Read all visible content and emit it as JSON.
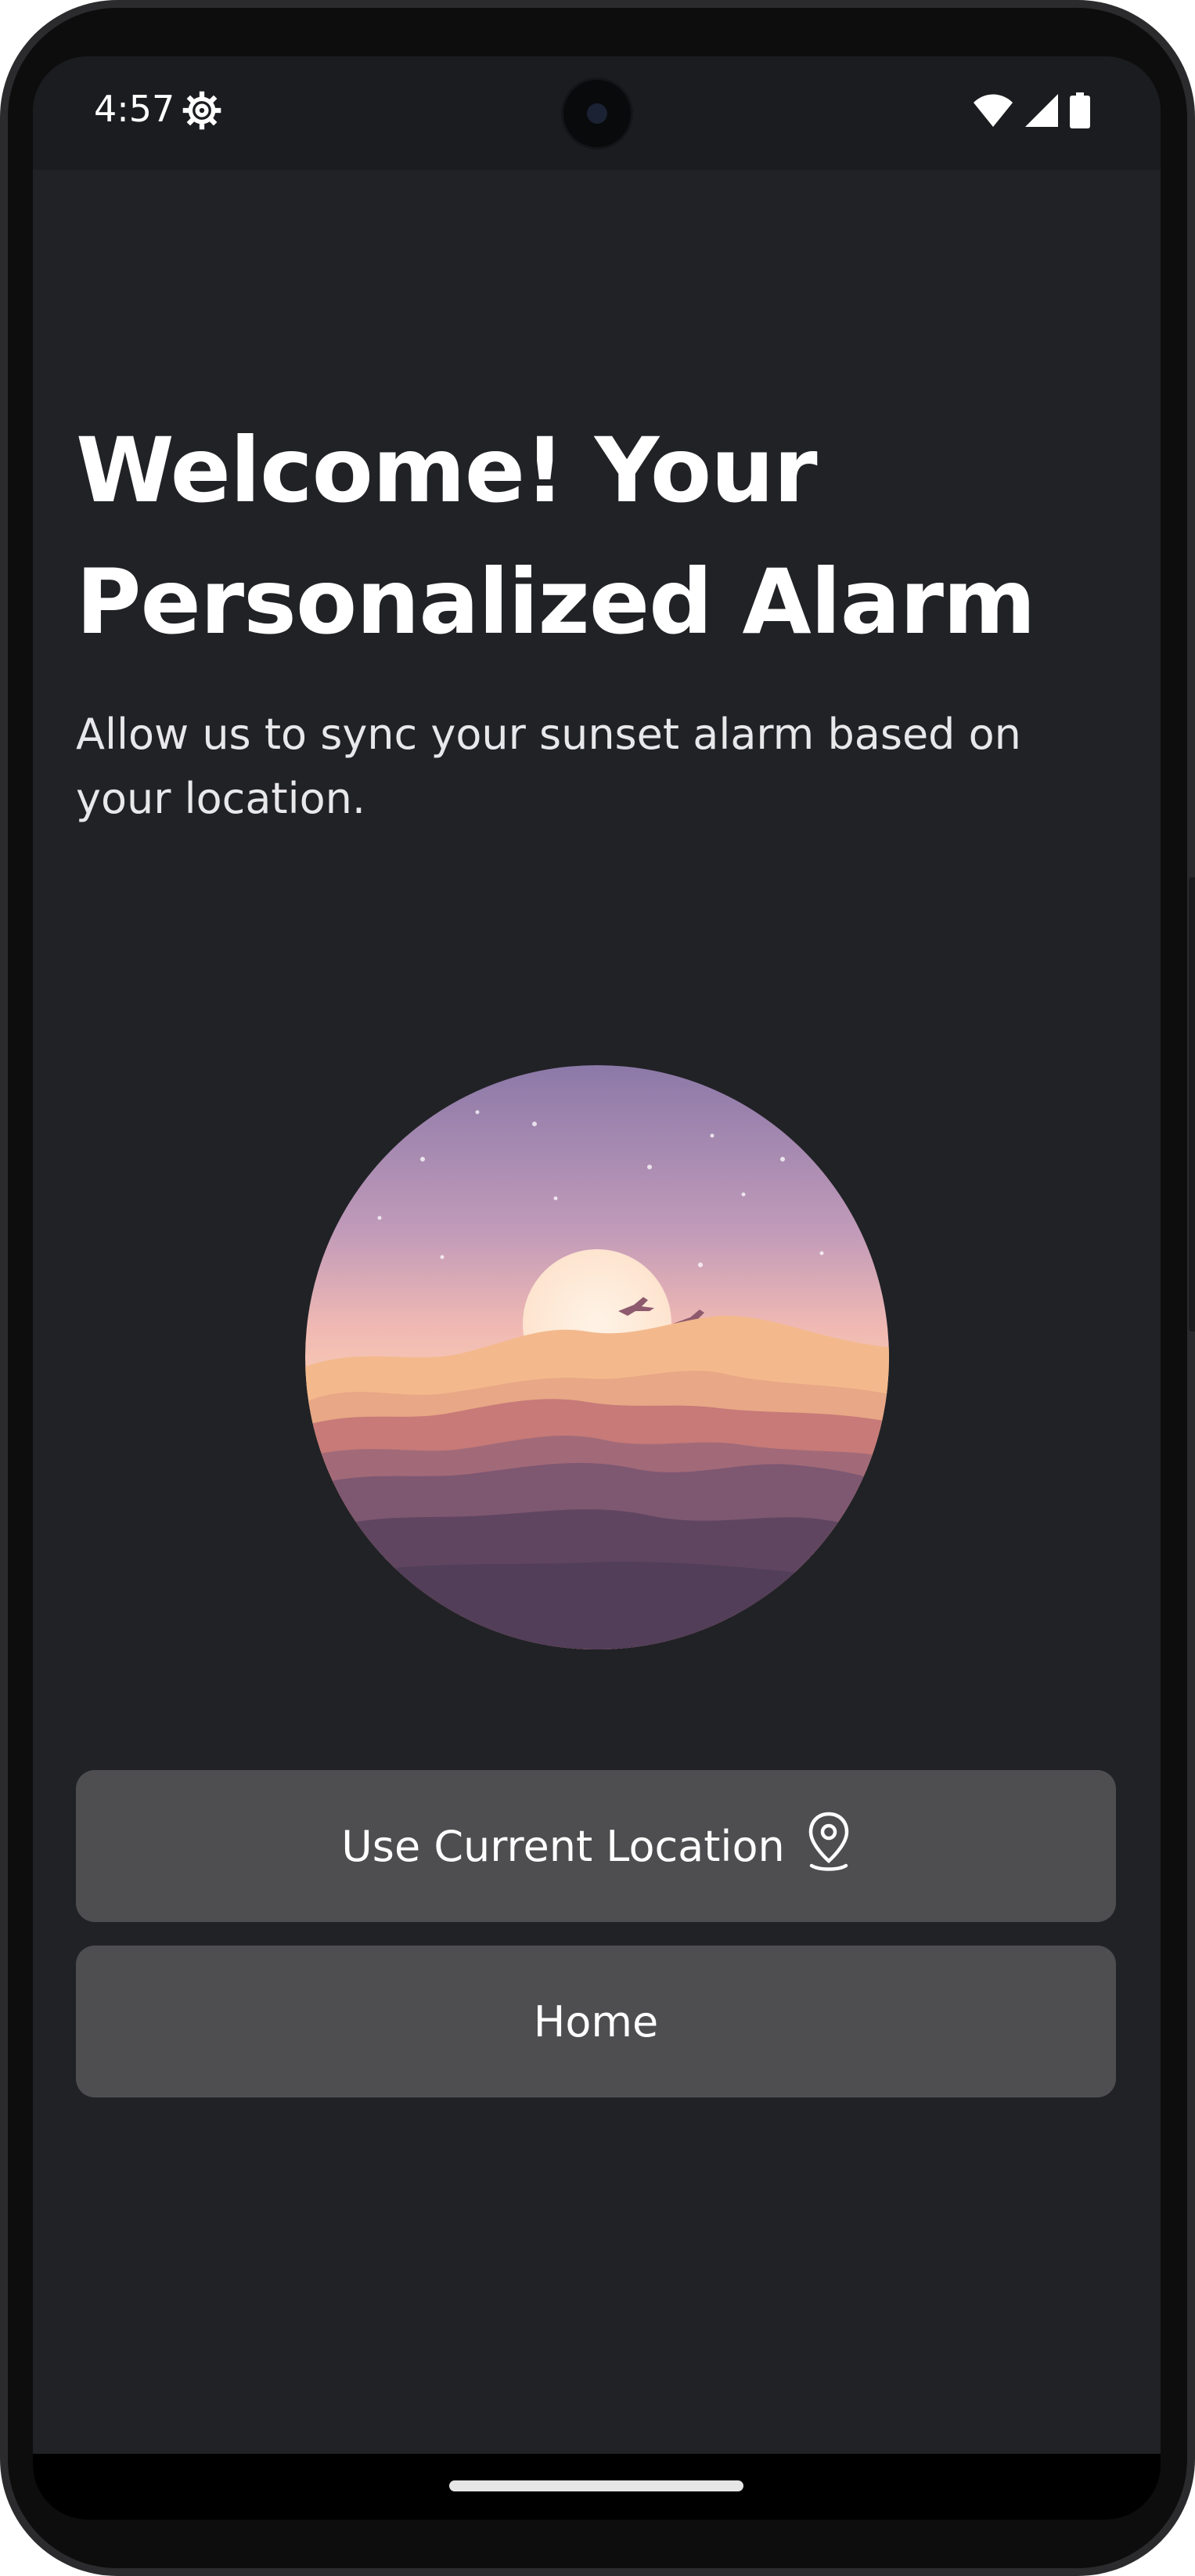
{
  "status_bar": {
    "time": "4:57",
    "settings_icon": "gear-icon",
    "wifi_icon": "wifi-icon",
    "signal_icon": "cell-signal-icon",
    "battery_icon": "battery-icon"
  },
  "onboarding": {
    "title": "Welcome! Your Personalized Alarm",
    "subtitle": "Allow us to sync your sunset alarm based on your location.",
    "illustration": "sunset-mountains-illustration"
  },
  "actions": {
    "use_location_label": "Use Current Location",
    "use_location_icon": "location-pin-icon",
    "home_label": "Home"
  },
  "colors": {
    "background": "#212226",
    "button": "#4e4e50",
    "text": "#ffffff"
  }
}
